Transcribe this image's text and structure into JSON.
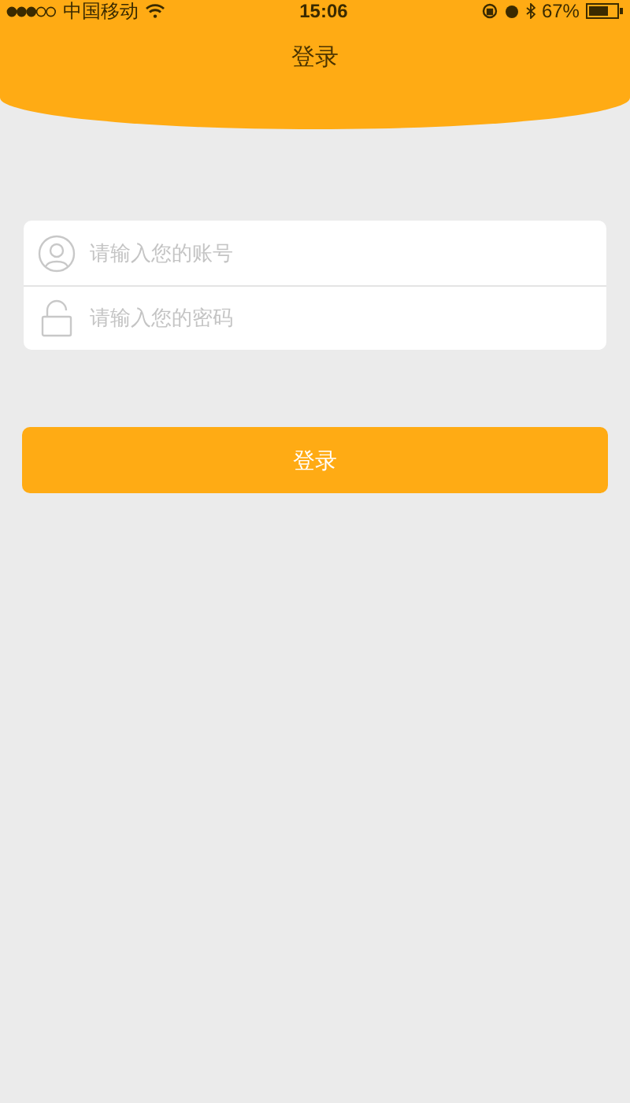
{
  "status_bar": {
    "carrier": "中国移动",
    "time": "15:06",
    "battery": "67%"
  },
  "header": {
    "title": "登录"
  },
  "form": {
    "fields": [
      {
        "kind": "account",
        "placeholder": "请输入您的账号"
      },
      {
        "kind": "password",
        "placeholder": "请输入您的密码"
      }
    ]
  },
  "login_button": {
    "label": "登录"
  }
}
